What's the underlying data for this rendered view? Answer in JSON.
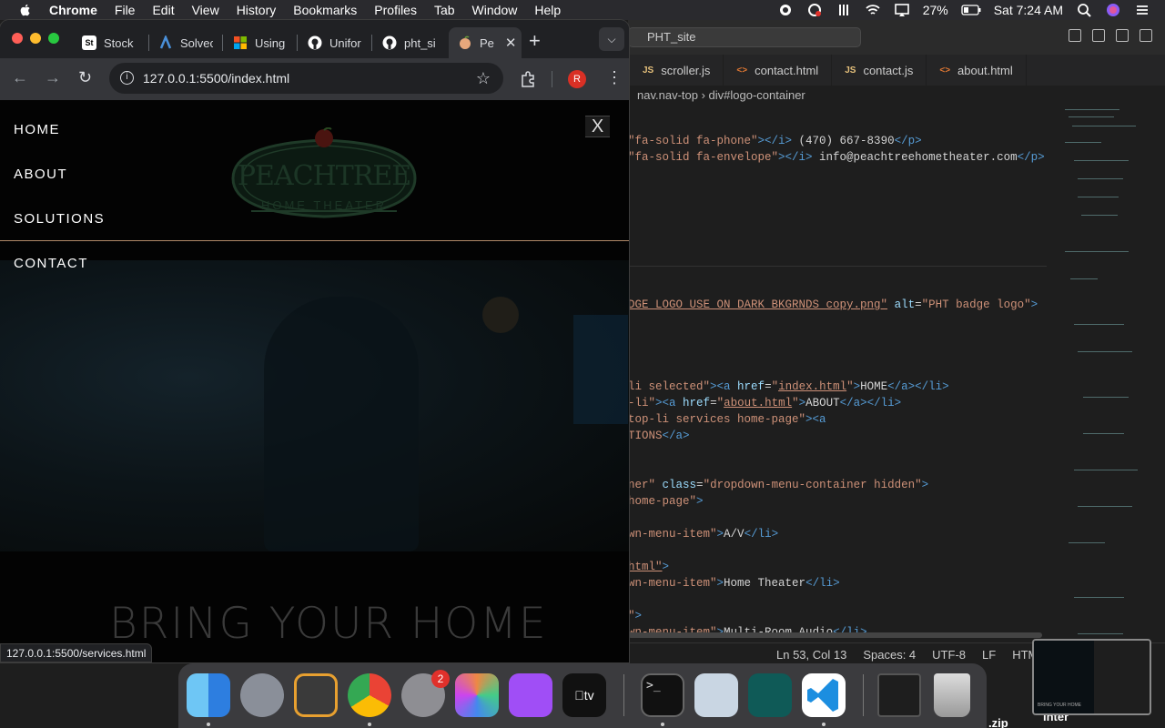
{
  "menubar": {
    "app": "Chrome",
    "items": [
      "File",
      "Edit",
      "View",
      "History",
      "Bookmarks",
      "Profiles",
      "Tab",
      "Window",
      "Help"
    ],
    "battery": "27%",
    "clock": "Sat 7:24 AM"
  },
  "chrome": {
    "tabs": [
      {
        "label": "Stock",
        "fav_color": "#222"
      },
      {
        "label": "Solvec",
        "fav_color": "#4a90d9"
      },
      {
        "label": "Using",
        "fav_color": "#f25022"
      },
      {
        "label": "Unifor",
        "fav_color": "#fff"
      },
      {
        "label": "pht_si",
        "fav_color": "#fff"
      },
      {
        "label": "Pe",
        "fav_color": "#e8a87c"
      }
    ],
    "url": "127.0.0.1:5500/index.html",
    "profile_initial": "R",
    "status_url": "127.0.0.1:5500/services.html"
  },
  "page": {
    "nav": [
      "HOME",
      "ABOUT",
      "SOLUTIONS",
      "CONTACT"
    ],
    "close": "X",
    "logo_main": "PEACHTREE",
    "logo_sub": "HOME THEATER",
    "headline": "BRING YOUR HOME"
  },
  "vscode": {
    "search": "PHT_site",
    "tabs": [
      {
        "type": "JS",
        "name": "scroller.js"
      },
      {
        "type": "<>",
        "name": "contact.html"
      },
      {
        "type": "JS",
        "name": "contact.js"
      },
      {
        "type": "<>",
        "name": "about.html"
      }
    ],
    "breadcrumb": [
      "nav.nav-top",
      "div#logo-container"
    ],
    "status": {
      "position": "Ln 53, Col 13",
      "spaces": "Spaces: 4",
      "encoding": "UTF-8",
      "eol": "LF",
      "lang": "HTML"
    }
  },
  "dock": {
    "settings_badge": "2"
  },
  "desktop": {
    "files": [
      ".zip",
      "inter"
    ],
    "thumb_caption": "BRING YOUR HOME"
  }
}
